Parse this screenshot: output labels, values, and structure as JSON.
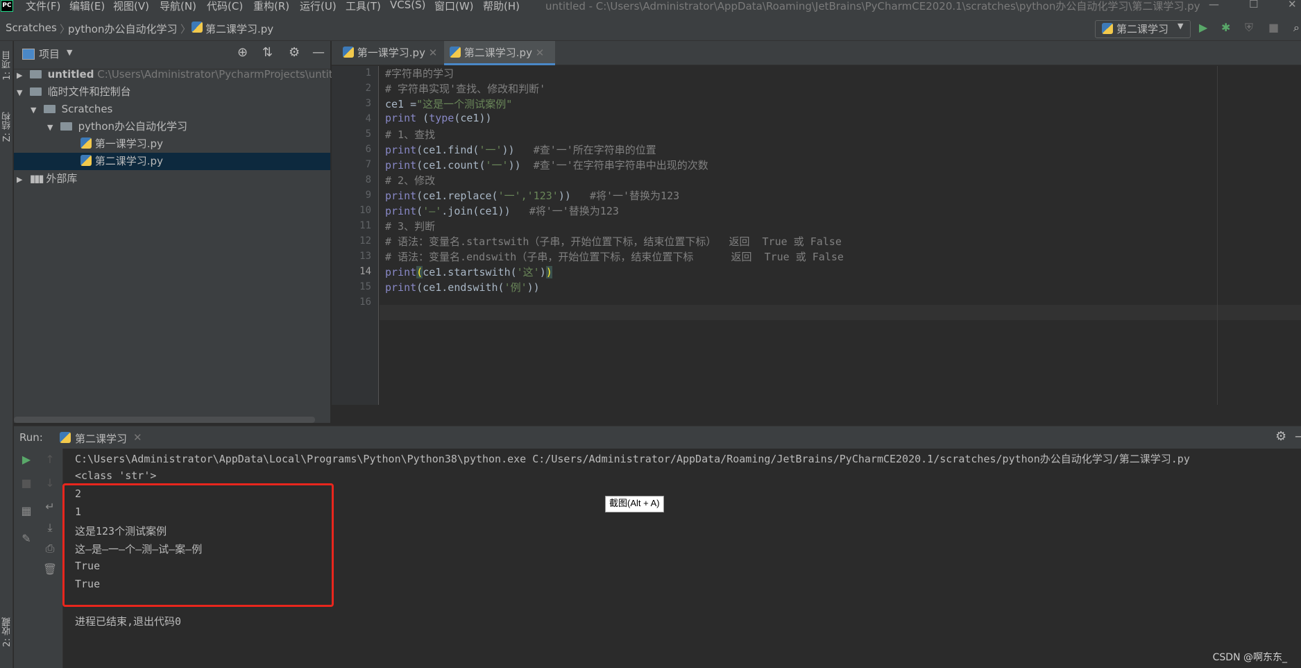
{
  "menu": {
    "logo": "PC",
    "items": [
      "文件(F)",
      "编辑(E)",
      "视图(V)",
      "导航(N)",
      "代码(C)",
      "重构(R)",
      "运行(U)",
      "工具(T)",
      "VCS(S)",
      "窗口(W)",
      "帮助(H)"
    ],
    "window_title": "untitled - C:\\Users\\Administrator\\AppData\\Roaming\\JetBrains\\PyCharmCE2020.1\\scratches\\python办公自动化学习\\第二课学习.py"
  },
  "breadcrumb": [
    "Scratches",
    "python办公自动化学习",
    "第二课学习.py"
  ],
  "run_config": {
    "label": "第二课学习"
  },
  "left_stripe": {
    "project": "1: 项目",
    "structure": "Z: 结构",
    "favorites": "2: 收藏"
  },
  "project_panel": {
    "title": "项目",
    "tree": [
      {
        "label": "untitled",
        "path": "C:\\Users\\Administrator\\PycharmProjects\\untitle"
      },
      {
        "label": "临时文件和控制台"
      },
      {
        "label": "Scratches"
      },
      {
        "label": "python办公自动化学习"
      },
      {
        "label": "第一课学习.py"
      },
      {
        "label": "第二课学习.py"
      },
      {
        "label": "外部库"
      }
    ]
  },
  "editor": {
    "tabs": [
      {
        "label": "第一课学习.py"
      },
      {
        "label": "第二课学习.py"
      }
    ],
    "line_numbers": [
      "1",
      "2",
      "3",
      "4",
      "5",
      "6",
      "7",
      "8",
      "9",
      "10",
      "11",
      "12",
      "13",
      "14",
      "15",
      "16"
    ],
    "lines": [
      {
        "c": "#字符串的学习"
      },
      {
        "c": "# 字符串实现'查找、修改和判断'"
      },
      {
        "a": "ce1 =",
        "s": "\"这是一个测试案例\""
      },
      {
        "bi": "print",
        "a": " (",
        "bi2": "type",
        "b": "(ce1))"
      },
      {
        "c": "# 1、查找"
      },
      {
        "bi": "print",
        "a": "(ce1.find(",
        "s": "'一'",
        "b": "))   ",
        "c2": "#查'一'所在字符串的位置"
      },
      {
        "bi": "print",
        "a": "(ce1.count(",
        "s": "'一'",
        "b": "))  ",
        "c2": "#查'一'在字符串字符串中出现的次数"
      },
      {
        "c": "# 2、修改"
      },
      {
        "bi": "print",
        "a": "(ce1.replace(",
        "s": "'一','123'",
        "b": "))   ",
        "c2": "#将'一'替换为123"
      },
      {
        "bi": "print",
        "a": "(",
        "s": "'—'",
        "b": ".join(ce1))   ",
        "c2": "#将'一'替换为123"
      },
      {
        "c": "# 3、判断"
      },
      {
        "c": "# 语法：变量名.startswith（子串，开始位置下标，结束位置下标）  返回  True 或 False"
      },
      {
        "c": "# 语法：变量名.endswith（子串，开始位置下标，结束位置下标      返回  True 或 False"
      },
      {
        "bi": "print",
        "h1": "(",
        "a": "ce1.startswith(",
        "s": "'这'",
        "b": ")",
        "h2": ")"
      },
      {
        "bi": "print",
        "a": "(ce1.endswith(",
        "s": "'例'",
        "b": "))"
      },
      {
        "a": ""
      }
    ]
  },
  "run": {
    "label": "Run:",
    "tab": "第二课学习",
    "output": [
      "C:\\Users\\Administrator\\AppData\\Local\\Programs\\Python\\Python38\\python.exe C:/Users/Administrator/AppData/Roaming/JetBrains/PyCharmCE2020.1/scratches/python办公自动化学习/第二课学习.py",
      "<class 'str'>",
      "2",
      "1",
      "这是123个测试案例",
      "这—是—一—个—测—试—案—例",
      "True",
      "True",
      "",
      "进程已结束,退出代码0"
    ]
  },
  "tooltip": "截图(Alt + A)",
  "watermark": "CSDN @啊东东_"
}
